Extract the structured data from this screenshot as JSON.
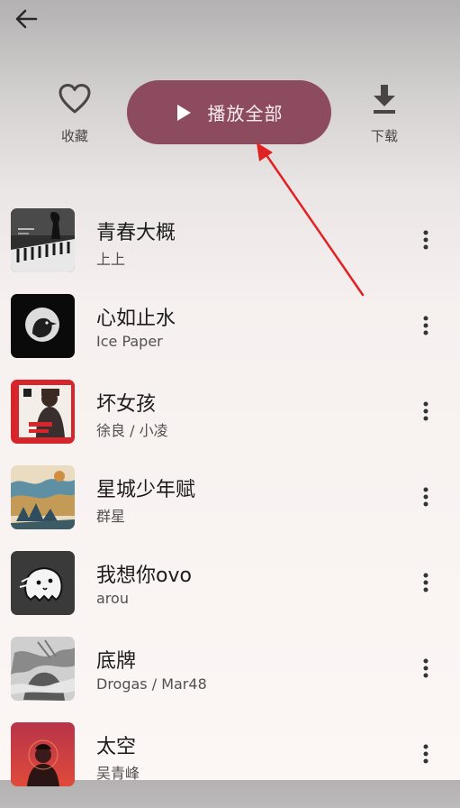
{
  "header": {
    "back_icon": "arrow-left-icon"
  },
  "actions": {
    "favorite": {
      "label": "收藏",
      "icon": "heart-outline-icon"
    },
    "play_all": {
      "label": "播放全部",
      "icon": "play-icon"
    },
    "download": {
      "label": "下载",
      "icon": "download-icon"
    }
  },
  "colors": {
    "play_button": "#8c4b5e",
    "annotation_arrow": "#e02222"
  },
  "songs": [
    {
      "title": "青春大概",
      "artist": "上上"
    },
    {
      "title": "心如止水",
      "artist": "Ice Paper"
    },
    {
      "title": "坏女孩",
      "artist": "徐良 / 小凌"
    },
    {
      "title": "星城少年赋",
      "artist": "群星"
    },
    {
      "title": "我想你ovo",
      "artist": "arou"
    },
    {
      "title": "底牌",
      "artist": "Drogas / Mar48"
    },
    {
      "title": "太空",
      "artist": "吴青峰"
    }
  ]
}
